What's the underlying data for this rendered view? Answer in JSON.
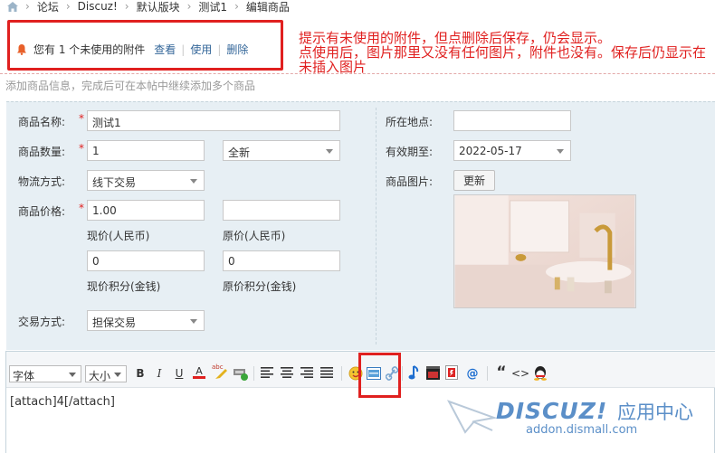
{
  "breadcrumb": {
    "items": [
      "论坛",
      "Discuz!",
      "默认版块",
      "测试1",
      "编辑商品"
    ]
  },
  "notice": {
    "text": "您有 1 个未使用的附件",
    "view": "查看",
    "use": "使用",
    "delete": "删除"
  },
  "annotation": {
    "line1": "提示有未使用的附件，但点删除后保存，仍会显示。",
    "line2": "点使用后，图片那里又没有任何图片，附件也没有。保存后仍显示在未插入图片"
  },
  "subtitle": "添加商品信息，完成后可在本帖中继续添加多个商品",
  "form": {
    "name_label": "商品名称:",
    "name_value": "测试1",
    "qty_label": "商品数量:",
    "qty_value": "1",
    "condition_value": "全新",
    "shipping_label": "物流方式:",
    "shipping_value": "线下交易",
    "price_label": "商品价格:",
    "price_value": "1.00",
    "price_caption": "现价(人民币)",
    "orig_price_value": "",
    "orig_price_caption": "原价(人民币)",
    "credit_value": "0",
    "credit_caption": "现价积分(金钱)",
    "orig_credit_value": "0",
    "orig_credit_caption": "原价积分(金钱)",
    "trade_label": "交易方式:",
    "trade_value": "担保交易",
    "location_label": "所在地点:",
    "location_value": "",
    "expiry_label": "有效期至:",
    "expiry_value": "2022-05-17",
    "image_label": "商品图片:",
    "replace_button": "更新",
    "required_mark": "*"
  },
  "editor": {
    "font_select": "字体",
    "size_select": "大小",
    "bold": "B",
    "italic": "I",
    "underline": "U",
    "color": "A",
    "spell": "abc",
    "quote": "“",
    "code": "<>",
    "at": "@",
    "content": "[attach]4[/attach]"
  },
  "watermark": {
    "logo": "DISCUZ!",
    "cn": "应用中心",
    "url": "addon.dismall.com"
  },
  "colors": {
    "accent_red": "#e0201f",
    "link": "#336699",
    "panel_bg": "#e7eff4",
    "watermark": "#5b8fc8"
  }
}
